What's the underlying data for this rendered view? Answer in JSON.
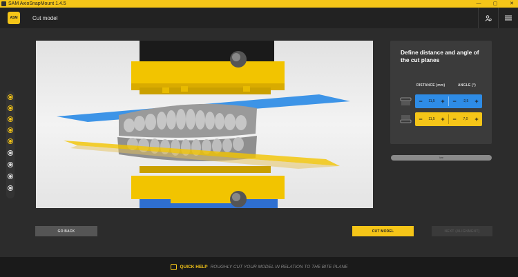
{
  "window": {
    "title": "SAM AxioSnapMount 1.4.5",
    "controls": [
      "—",
      "▢",
      "✕"
    ]
  },
  "header": {
    "logo_text": "ASM",
    "page_title": "Cut model"
  },
  "panel": {
    "title": "Define distance and angle of the cut planes",
    "col_distance": "DISTANCE (mm)",
    "col_angle": "ANGLE (°)",
    "rows": [
      {
        "plane": "upper",
        "color": "#2e8ce6",
        "distance": "11,5",
        "angle": "-2,5"
      },
      {
        "plane": "lower",
        "color": "#f5c518",
        "distance": "11,5",
        "angle": "7,0"
      }
    ],
    "slider_label": "lore"
  },
  "stepper": {
    "total": 9,
    "completed": 5,
    "tools": [
      "expand-icon",
      "focus-icon"
    ]
  },
  "buttons": {
    "back": "GO BACK",
    "cut": "CUT MODEL",
    "next": "NEXT (ALIGNMENT)"
  },
  "footer": {
    "label": "QUICK HELP",
    "text": "ROUGHLY CUT YOUR MODEL IN RELATION TO THE BITE PLANE"
  },
  "colors": {
    "accent": "#f5c518",
    "blue_plane": "#2e8ce6",
    "background": "#2c2c2c"
  }
}
